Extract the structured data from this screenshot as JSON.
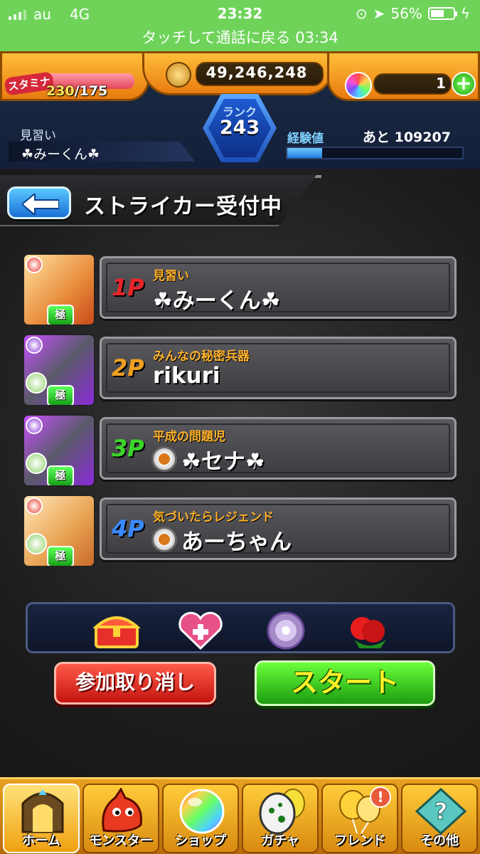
{
  "status_bar": {
    "carrier": "au",
    "network": "4G",
    "time": "23:32",
    "battery": "56%"
  },
  "call_banner": "タッチして通話に戻る 03:34",
  "header": {
    "stamina_label": "スタミナ",
    "stamina_current": "230",
    "stamina_max": "/175",
    "coins": "49,246,248",
    "orbs": "1",
    "rank_label": "ランク",
    "rank": "243",
    "player_title": "見習い",
    "player_name": "☘みーくん☘",
    "exp_label": "経験値",
    "exp_remaining": "あと 109207",
    "exp_fraction": 0.2
  },
  "screen": {
    "title": "ストライカー受付中"
  },
  "players": [
    {
      "slot": "1P",
      "title": "見習い",
      "name": "☘みーくん☘",
      "slot_color": "#e8252a",
      "has_medal": false,
      "goku": "極",
      "badge_color": "#e83a2a"
    },
    {
      "slot": "2P",
      "title": "みんなの秘密兵器",
      "name": "rikuri",
      "slot_color": "#f0a020",
      "has_medal": false,
      "goku": "極",
      "badge_color": "#8a3ad8"
    },
    {
      "slot": "3P",
      "title": "平成の問題児",
      "name": "☘セナ☘",
      "slot_color": "#3ad82a",
      "has_medal": true,
      "goku": "極",
      "badge_color": "#8a3ad8"
    },
    {
      "slot": "4P",
      "title": "気づいたらレジェンド",
      "name": "あーちゃん",
      "slot_color": "#3a8aff",
      "has_medal": true,
      "goku": "極",
      "badge_color": "#e83a2a"
    }
  ],
  "items": [
    "treasure-chest-icon",
    "heart-plus-icon",
    "purple-orb-icon",
    "red-fruit-icon"
  ],
  "buttons": {
    "cancel": "参加取り消し",
    "start": "スタート"
  },
  "nav": [
    {
      "name": "home",
      "label": "ホーム",
      "icon": "home-gate-icon"
    },
    {
      "name": "monster",
      "label": "モンスター",
      "icon": "dragon-icon"
    },
    {
      "name": "shop",
      "label": "ショップ",
      "icon": "rainbow-orb-icon"
    },
    {
      "name": "gacha",
      "label": "ガチャ",
      "icon": "egg-icon"
    },
    {
      "name": "friend",
      "label": "フレンド",
      "icon": "balloons-icon",
      "notice": "!"
    },
    {
      "name": "other",
      "label": "その他",
      "icon": "question-diamond-icon"
    }
  ]
}
